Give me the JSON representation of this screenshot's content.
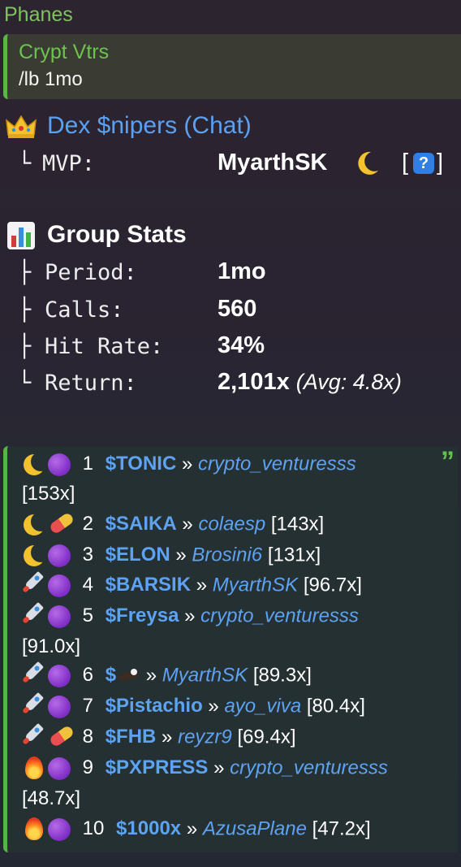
{
  "sender": "Phanes",
  "reply": {
    "name": "Crypt Vtrs",
    "text": "/lb 1mo"
  },
  "group": {
    "title": "Dex $nipers (Chat)",
    "mvp_prefix": "└",
    "mvp_label": "MVP:",
    "mvp_value": "MyarthSK",
    "mvp_icon": "crescent-moon",
    "link_open": "[",
    "link_icon": "?",
    "link_close": "]"
  },
  "stats": {
    "title": "Group Stats",
    "rows": [
      {
        "prefix": "├",
        "label": "Period:",
        "value": "1mo"
      },
      {
        "prefix": "├",
        "label": "Calls:",
        "value": "560"
      },
      {
        "prefix": "├",
        "label": "Hit Rate:",
        "value": "34%"
      },
      {
        "prefix": "└",
        "label": "Return:",
        "value": "2,101x",
        "extra": "(Avg: 4.8x)"
      }
    ]
  },
  "leaderboard": {
    "quote_mark": "”",
    "separator": "»",
    "entries": [
      {
        "icons": [
          "crescent-moon",
          "purple-circle"
        ],
        "rank": "1",
        "ticker": "$TONIC",
        "user": "crypto_venturesss",
        "mult": "[153x]"
      },
      {
        "icons": [
          "crescent-moon",
          "pill"
        ],
        "rank": "2",
        "ticker": "$SAIKA",
        "user": "colaesp",
        "mult": "[143x]"
      },
      {
        "icons": [
          "crescent-moon",
          "purple-circle"
        ],
        "rank": "3",
        "ticker": "$ELON",
        "user": "Brosini6",
        "mult": "[131x]"
      },
      {
        "icons": [
          "rocket",
          "purple-circle"
        ],
        "rank": "4",
        "ticker": "$BARSIK",
        "user": "MyarthSK",
        "mult": "[96.7x]"
      },
      {
        "icons": [
          "rocket",
          "purple-circle"
        ],
        "rank": "5",
        "ticker": "$Freysa",
        "user": "crypto_venturesss",
        "mult": "[91.0x]"
      },
      {
        "icons": [
          "rocket",
          "purple-circle"
        ],
        "rank": "6",
        "ticker": "$",
        "ticker_icon": "eagle",
        "user": "MyarthSK",
        "mult": "[89.3x]"
      },
      {
        "icons": [
          "rocket",
          "purple-circle"
        ],
        "rank": "7",
        "ticker": "$Pistachio",
        "user": "ayo_viva",
        "mult": "[80.4x]"
      },
      {
        "icons": [
          "rocket",
          "pill"
        ],
        "rank": "8",
        "ticker": "$FHB",
        "user": "reyzr9",
        "mult": "[69.4x]"
      },
      {
        "icons": [
          "fire",
          "purple-circle"
        ],
        "rank": "9",
        "ticker": "$PXPRESS",
        "user": "crypto_venturesss",
        "mult": "[48.7x]"
      },
      {
        "icons": [
          "fire",
          "purple-circle"
        ],
        "rank": "10",
        "ticker": "$1000x",
        "user": "AzusaPlane",
        "mult": "[47.2x]"
      }
    ]
  },
  "colors": {
    "accent_green": "#5db546",
    "link_blue": "#5ea2f2"
  }
}
